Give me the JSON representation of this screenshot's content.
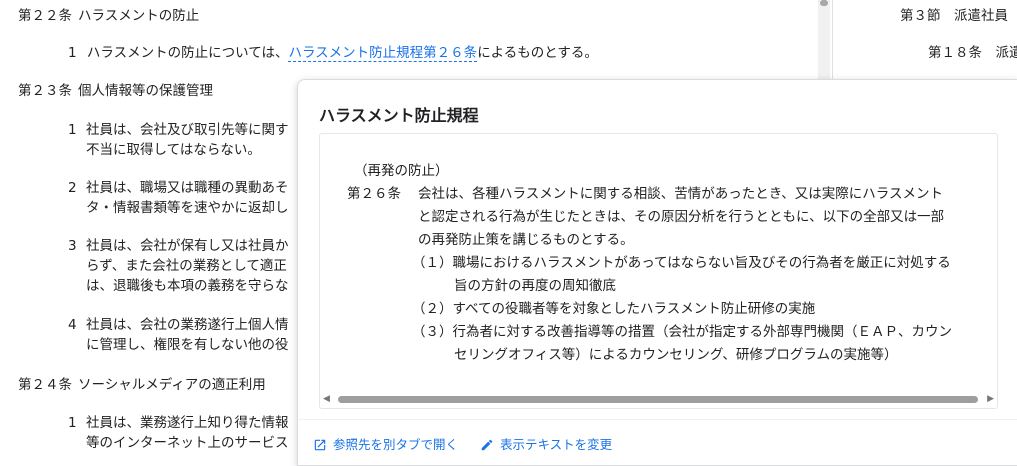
{
  "document": {
    "art22_num": "第２２条",
    "art22_title": "ハラスメントの防止",
    "art22_p1_num": "1",
    "art22_p1_before": "ハラスメントの防止については、",
    "art22_p1_link": "ハラスメント防止規程第２６条",
    "art22_p1_after": "によるものとする。",
    "art23_num": "第２３条",
    "art23_title": "個人情報等の保護管理",
    "art23_p1_num": "1",
    "art23_p1_l1": "社員は、会社及び取引先等に関す",
    "art23_p1_l2": "不当に取得してはならない。",
    "art23_p2_num": "2",
    "art23_p2_l1": "社員は、職場又は職種の異動あそ",
    "art23_p2_l2": "タ・情報書類等を速やかに返却し",
    "art23_p3_num": "3",
    "art23_p3_l1": "社員は、会社が保有し又は社員か",
    "art23_p3_l2": "らず、また会社の業務として適正",
    "art23_p3_l3": "は、退職後も本項の義務を守らな",
    "art23_p4_num": "4",
    "art23_p4_l1": "社員は、会社の業務遂行上個人情",
    "art23_p4_l2": "に管理し、権限を有しない他の役",
    "art24_num": "第２４条",
    "art24_title": "ソーシャルメディアの適正利用",
    "art24_p1_num": "1",
    "art24_p1_l1": "社員は、業務遂行上知り得た情報",
    "art24_p1_l2": "等のインターネット上のサービス"
  },
  "right_panel": {
    "section": "第３節　派遣社員",
    "article": "第１８条　派遣"
  },
  "popup": {
    "title": "ハラスメント防止規程",
    "heading": "（再発の防止）",
    "article_num": "第２６条",
    "body_l1": "会社は、各種ハラスメントに関する相談、苦情があったとき、又は実際にハラスメント",
    "body_l2": "と認定される行為が生じたときは、その原因分析を行うとともに、以下の全部又は一部",
    "body_l3": "の再発防止策を講じるものとする。",
    "item1_l1": "（１）職場におけるハラスメントがあってはならない旨及びその行為者を厳正に対処する",
    "item1_l2": "旨の方針の再度の周知徹底",
    "item2": "（２）すべての役職者等を対象としたハラスメント防止研修の実施",
    "item3_l1": "（３）行為者に対する改善指導等の措置（会社が指定する外部専門機関（ＥＡＰ、カウン",
    "item3_l2": "セリングオフィス等）によるカウンセリング、研修プログラムの実施等）",
    "open_tab_label": "参照先を別タブで開く",
    "edit_text_label": "表示テキストを変更",
    "scroll_left": "◀",
    "scroll_right": "▶"
  },
  "colors": {
    "link": "#1a73e8",
    "text": "#222222"
  },
  "icons": {
    "open_tab": "open-in-new-icon",
    "edit": "pencil-icon"
  }
}
